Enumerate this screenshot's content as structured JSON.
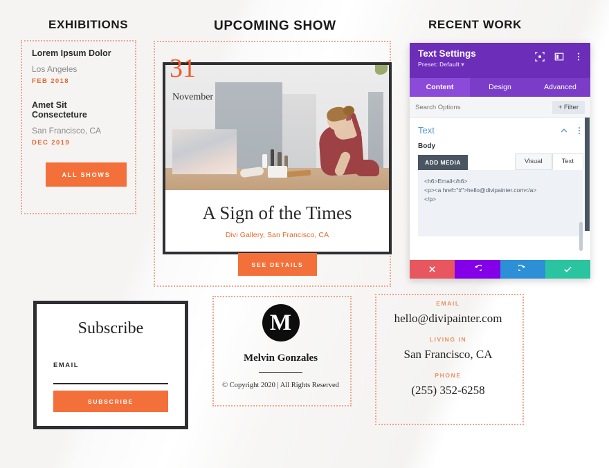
{
  "sections": {
    "exhibitions_title": "EXHIBITIONS",
    "upcoming_title": "UPCOMING SHOW",
    "recent_title": "RECENT WORK"
  },
  "exhibitions": {
    "items": [
      {
        "name": "Lorem Ipsum Dolor",
        "city": "Los Angeles",
        "date": "FEB 2018"
      },
      {
        "name": "Amet Sit Consecteture",
        "city": "San Francisco, CA",
        "date": "DEC 2019"
      }
    ],
    "button_label": "ALL SHOWS"
  },
  "upcoming_show": {
    "day": "31",
    "month": "November",
    "title": "A Sign of the Times",
    "venue": "Divi Gallery, San Francisco, CA",
    "button_label": "SEE DETAILS"
  },
  "divi_panel": {
    "title": "Text Settings",
    "preset": "Preset: Default",
    "tabs": [
      {
        "label": "Content",
        "active": true
      },
      {
        "label": "Design",
        "active": false
      },
      {
        "label": "Advanced",
        "active": false
      }
    ],
    "header_icons": [
      "focus-icon",
      "split-view-icon",
      "more-options-icon"
    ],
    "search_placeholder": "Search Options",
    "filter_label": "+ Filter",
    "section_label": "Text",
    "body_label": "Body",
    "add_media_label": "ADD MEDIA",
    "editor_tabs": [
      {
        "label": "Visual",
        "active": false
      },
      {
        "label": "Text",
        "active": true
      }
    ],
    "code": "<h6>Email</h6>\n<p><a href=\"#\">hello@divipainter.com</a>\n</p>",
    "actions": [
      {
        "name": "cancel",
        "glyph": "✖",
        "color": "#e8575f"
      },
      {
        "name": "undo",
        "glyph": "↺",
        "color": "#8300e9"
      },
      {
        "name": "redo",
        "glyph": "↻",
        "color": "#2d8fd5"
      },
      {
        "name": "save",
        "glyph": "✔",
        "color": "#2bc4a0"
      }
    ]
  },
  "subscribe": {
    "heading": "Subscribe",
    "email_label": "EMAIL",
    "email_value": "",
    "email_placeholder": "",
    "button_label": "SUBSCRIBE"
  },
  "signature": {
    "logo_letter": "M",
    "name": "Melvin Gonzales",
    "copyright": "© Copyright 2020 | All Rights Reserved"
  },
  "contact": {
    "rows": [
      {
        "label": "EMAIL",
        "value": "hello@divipainter.com"
      },
      {
        "label": "LIVING IN",
        "value": "San Francisco, CA"
      },
      {
        "label": "PHONE",
        "value": "(255) 352-6258"
      }
    ]
  },
  "colors": {
    "orange": "#f4703a",
    "orange_text": "#e8672c",
    "dotted_border": "#f0a58c",
    "divi_purple": "#6c2eb9",
    "dark": "#2f2f33"
  }
}
